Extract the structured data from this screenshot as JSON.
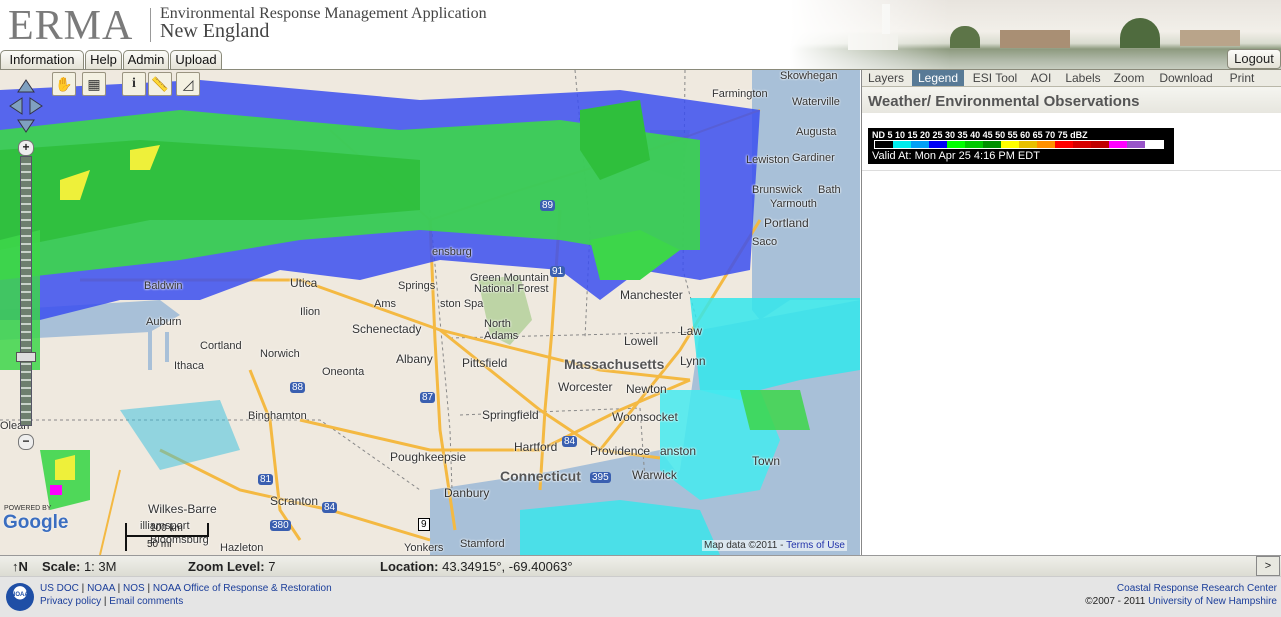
{
  "header": {
    "logo": "ERMA",
    "title_line1": "Environmental Response Management Application",
    "title_line2": "New England",
    "nav": [
      "Information",
      "Help",
      "Admin",
      "Upload"
    ],
    "logout": "Logout"
  },
  "map": {
    "tool_icons": [
      "hand-pan-icon",
      "map-overview-icon",
      "info-icon",
      "ruler-icon",
      "area-measure-icon"
    ],
    "info_label": "i",
    "labels": {
      "skowhegan": "Skowhegan",
      "farmington": "Farmington",
      "waterville": "Waterville",
      "augusta": "Augusta",
      "lewiston": "Lewiston",
      "gardiner": "Gardiner",
      "brunswick": "Brunswick",
      "bath": "Bath",
      "yarmouth": "Yarmouth",
      "portland": "Portland",
      "saco": "Saco",
      "baldwinsville": "Baldwin",
      "utica": "Utica",
      "auburn": "Auburn",
      "ilion": "Ilion",
      "cortland": "Cortland",
      "norwich": "Norwich",
      "ithaca": "Ithaca",
      "oneonta": "Oneonta",
      "binghamton": "Binghamton",
      "olean": "Olean",
      "schenectady": "Schenectady",
      "albany": "Albany",
      "amsterdam": "Ams",
      "springs": "Springs",
      "glens": "ensburg",
      "green_mountain": "Green Mountain",
      "national_forest": "National Forest",
      "manchester": "Manchester",
      "lowell": "Lowell",
      "lynn": "Lynn",
      "massachusetts": "Massachusetts",
      "worcester": "Worcester",
      "newton": "Newton",
      "pittsfield": "Pittsfield",
      "springfield": "Springfield",
      "woonsocket": "Woonsocket",
      "hartford": "Hartford",
      "providence": "Providence",
      "connecticut": "Connecticut",
      "poughkeepsie": "Poughkeepsie",
      "danbury": "Danbury",
      "scranton": "Scranton",
      "wilkes_barre": "Wilkes-Barre",
      "williamsport": "illiamsport",
      "bloomsburg": "Bloomsburg",
      "hazleton": "Hazleton",
      "yonkers": "Yonkers",
      "stamford": "Stamford",
      "north": "North",
      "adams": "Adams",
      "preston": "ston Spa",
      "town": "Town",
      "warwick": "Warwick",
      "cranston": "anston",
      "lawrence": "Law"
    },
    "highways": [
      "89",
      "91",
      "88",
      "87",
      "84",
      "81",
      "380",
      "84",
      "395",
      "9"
    ],
    "powered_by": "POWERED BY",
    "google": "Google",
    "scale_km": "100 km",
    "scale_mi": "50 mi",
    "attribution": "Map data ©2011",
    "separator": " - ",
    "terms": "Terms of Use"
  },
  "panel": {
    "tabs": [
      "Layers",
      "Legend",
      "ESI Tool",
      "AOI",
      "Labels",
      "Zoom",
      "Download",
      "Print"
    ],
    "active_tab": "Legend",
    "title": "Weather/ Environmental Observations",
    "legend": {
      "values_text": "ND  5  10 15 20 25 30 35 40 45 50 55 60 65 70 75 dBZ",
      "colors": [
        "#000000",
        "#00ecec",
        "#01a0f6",
        "#0000f6",
        "#00ff00",
        "#00c800",
        "#009000",
        "#ffff00",
        "#e7c000",
        "#ff9000",
        "#ff0000",
        "#d60000",
        "#c00000",
        "#ff00ff",
        "#9955c9",
        "#ffffff"
      ],
      "valid": "Valid At: Mon Apr 25 4:16 PM EDT"
    }
  },
  "status": {
    "north_icon": "north-arrow-icon",
    "north": "↑N",
    "scale_label": "Scale:",
    "scale_value": "1: 3M",
    "zoom_label": "Zoom Level:",
    "zoom_value": "7",
    "location_label": "Location:",
    "location_value": "43.34915°, -69.40063°",
    "expand": ">"
  },
  "footer": {
    "noaa": "NOAA",
    "left_line1": [
      "US DOC",
      "NOAA",
      "NOS",
      "NOAA Office of Response & Restoration"
    ],
    "left_line2": [
      "Privacy policy",
      "Email comments"
    ],
    "right_line1": "Coastal Response Research Center",
    "right_line2_prefix": "©2007 - 2011",
    "right_line2_link": "University of New Hampshire"
  }
}
